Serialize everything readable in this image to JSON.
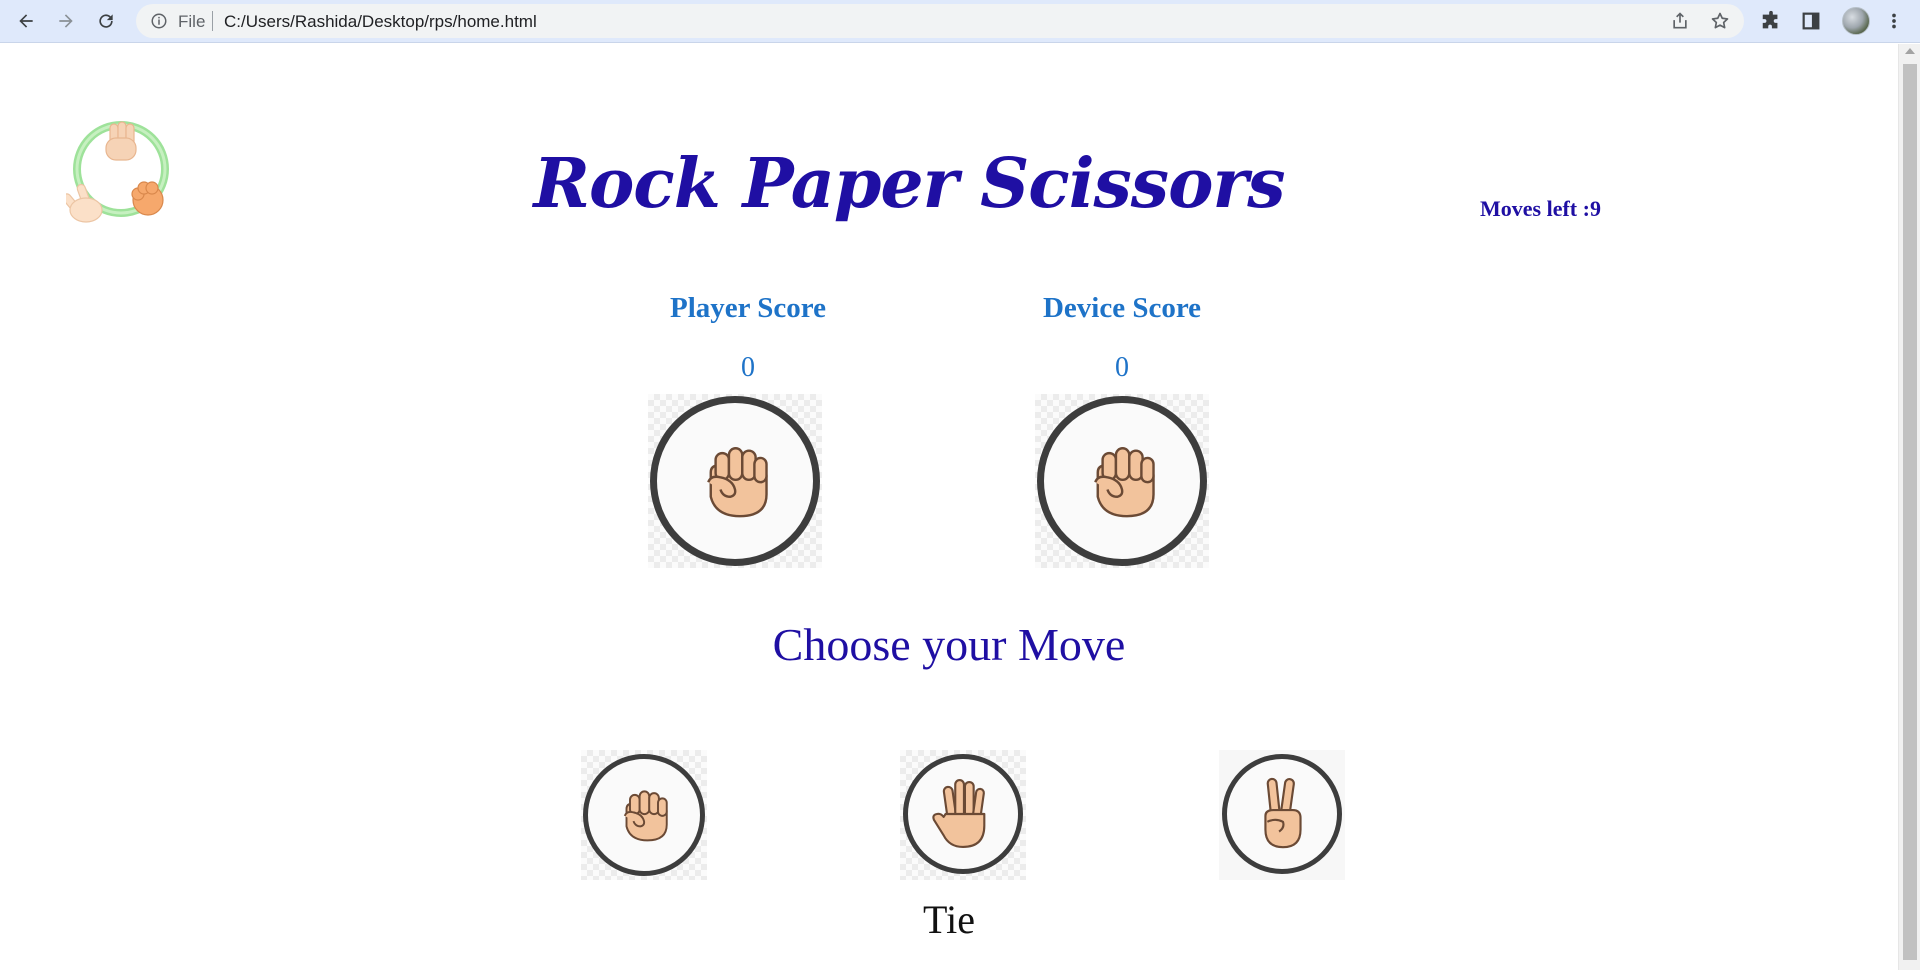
{
  "browser": {
    "file_label": "File",
    "url": "C:/Users/Rashida/Desktop/rps/home.html"
  },
  "game": {
    "title": "Rock Paper Scissors",
    "moves_left": "Moves left :9",
    "player_score_label": "Player Score",
    "device_score_label": "Device Score",
    "player_score": "0",
    "device_score": "0",
    "player_choice_icon": "rock-fist",
    "device_choice_icon": "rock-fist",
    "choose_prompt": "Choose your Move",
    "moves": [
      {
        "name": "rock",
        "icon": "rock-fist"
      },
      {
        "name": "paper",
        "icon": "paper-hand"
      },
      {
        "name": "scissors",
        "icon": "scissors-hand"
      }
    ],
    "result": "Tie"
  },
  "colors": {
    "title": "#1f0fa3",
    "score": "#1e73c8",
    "ring": "#3d3d3d",
    "skin": "#f2c39c",
    "skin_outline": "#6b4a35"
  }
}
